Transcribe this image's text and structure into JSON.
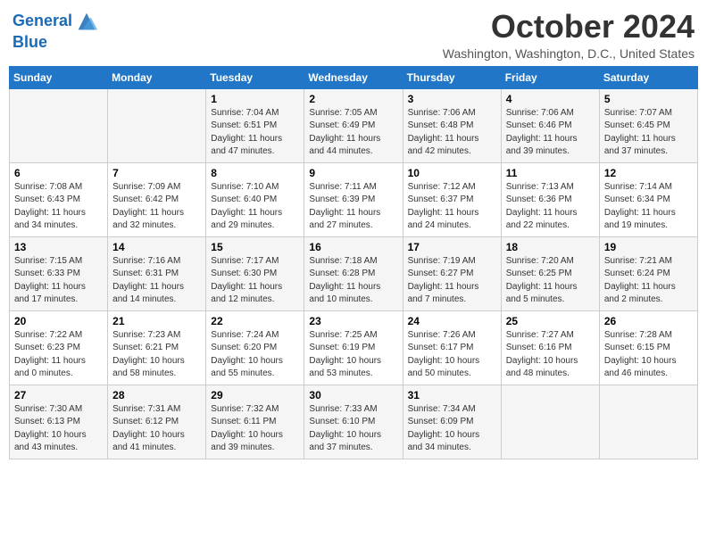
{
  "header": {
    "logo_line1": "General",
    "logo_line2": "Blue",
    "month": "October 2024",
    "location": "Washington, Washington, D.C., United States"
  },
  "days_of_week": [
    "Sunday",
    "Monday",
    "Tuesday",
    "Wednesday",
    "Thursday",
    "Friday",
    "Saturday"
  ],
  "weeks": [
    [
      {
        "day": "",
        "info": ""
      },
      {
        "day": "",
        "info": ""
      },
      {
        "day": "1",
        "info": "Sunrise: 7:04 AM\nSunset: 6:51 PM\nDaylight: 11 hours and 47 minutes."
      },
      {
        "day": "2",
        "info": "Sunrise: 7:05 AM\nSunset: 6:49 PM\nDaylight: 11 hours and 44 minutes."
      },
      {
        "day": "3",
        "info": "Sunrise: 7:06 AM\nSunset: 6:48 PM\nDaylight: 11 hours and 42 minutes."
      },
      {
        "day": "4",
        "info": "Sunrise: 7:06 AM\nSunset: 6:46 PM\nDaylight: 11 hours and 39 minutes."
      },
      {
        "day": "5",
        "info": "Sunrise: 7:07 AM\nSunset: 6:45 PM\nDaylight: 11 hours and 37 minutes."
      }
    ],
    [
      {
        "day": "6",
        "info": "Sunrise: 7:08 AM\nSunset: 6:43 PM\nDaylight: 11 hours and 34 minutes."
      },
      {
        "day": "7",
        "info": "Sunrise: 7:09 AM\nSunset: 6:42 PM\nDaylight: 11 hours and 32 minutes."
      },
      {
        "day": "8",
        "info": "Sunrise: 7:10 AM\nSunset: 6:40 PM\nDaylight: 11 hours and 29 minutes."
      },
      {
        "day": "9",
        "info": "Sunrise: 7:11 AM\nSunset: 6:39 PM\nDaylight: 11 hours and 27 minutes."
      },
      {
        "day": "10",
        "info": "Sunrise: 7:12 AM\nSunset: 6:37 PM\nDaylight: 11 hours and 24 minutes."
      },
      {
        "day": "11",
        "info": "Sunrise: 7:13 AM\nSunset: 6:36 PM\nDaylight: 11 hours and 22 minutes."
      },
      {
        "day": "12",
        "info": "Sunrise: 7:14 AM\nSunset: 6:34 PM\nDaylight: 11 hours and 19 minutes."
      }
    ],
    [
      {
        "day": "13",
        "info": "Sunrise: 7:15 AM\nSunset: 6:33 PM\nDaylight: 11 hours and 17 minutes."
      },
      {
        "day": "14",
        "info": "Sunrise: 7:16 AM\nSunset: 6:31 PM\nDaylight: 11 hours and 14 minutes."
      },
      {
        "day": "15",
        "info": "Sunrise: 7:17 AM\nSunset: 6:30 PM\nDaylight: 11 hours and 12 minutes."
      },
      {
        "day": "16",
        "info": "Sunrise: 7:18 AM\nSunset: 6:28 PM\nDaylight: 11 hours and 10 minutes."
      },
      {
        "day": "17",
        "info": "Sunrise: 7:19 AM\nSunset: 6:27 PM\nDaylight: 11 hours and 7 minutes."
      },
      {
        "day": "18",
        "info": "Sunrise: 7:20 AM\nSunset: 6:25 PM\nDaylight: 11 hours and 5 minutes."
      },
      {
        "day": "19",
        "info": "Sunrise: 7:21 AM\nSunset: 6:24 PM\nDaylight: 11 hours and 2 minutes."
      }
    ],
    [
      {
        "day": "20",
        "info": "Sunrise: 7:22 AM\nSunset: 6:23 PM\nDaylight: 11 hours and 0 minutes."
      },
      {
        "day": "21",
        "info": "Sunrise: 7:23 AM\nSunset: 6:21 PM\nDaylight: 10 hours and 58 minutes."
      },
      {
        "day": "22",
        "info": "Sunrise: 7:24 AM\nSunset: 6:20 PM\nDaylight: 10 hours and 55 minutes."
      },
      {
        "day": "23",
        "info": "Sunrise: 7:25 AM\nSunset: 6:19 PM\nDaylight: 10 hours and 53 minutes."
      },
      {
        "day": "24",
        "info": "Sunrise: 7:26 AM\nSunset: 6:17 PM\nDaylight: 10 hours and 50 minutes."
      },
      {
        "day": "25",
        "info": "Sunrise: 7:27 AM\nSunset: 6:16 PM\nDaylight: 10 hours and 48 minutes."
      },
      {
        "day": "26",
        "info": "Sunrise: 7:28 AM\nSunset: 6:15 PM\nDaylight: 10 hours and 46 minutes."
      }
    ],
    [
      {
        "day": "27",
        "info": "Sunrise: 7:30 AM\nSunset: 6:13 PM\nDaylight: 10 hours and 43 minutes."
      },
      {
        "day": "28",
        "info": "Sunrise: 7:31 AM\nSunset: 6:12 PM\nDaylight: 10 hours and 41 minutes."
      },
      {
        "day": "29",
        "info": "Sunrise: 7:32 AM\nSunset: 6:11 PM\nDaylight: 10 hours and 39 minutes."
      },
      {
        "day": "30",
        "info": "Sunrise: 7:33 AM\nSunset: 6:10 PM\nDaylight: 10 hours and 37 minutes."
      },
      {
        "day": "31",
        "info": "Sunrise: 7:34 AM\nSunset: 6:09 PM\nDaylight: 10 hours and 34 minutes."
      },
      {
        "day": "",
        "info": ""
      },
      {
        "day": "",
        "info": ""
      }
    ]
  ]
}
